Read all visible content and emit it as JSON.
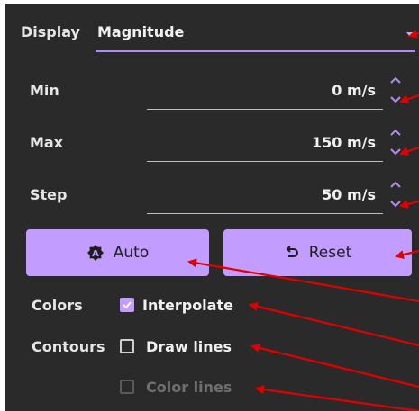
{
  "display": {
    "label": "Display",
    "value": "Magnitude"
  },
  "fields": [
    {
      "label": "Min",
      "value": "0 m/s"
    },
    {
      "label": "Max",
      "value": "150 m/s"
    },
    {
      "label": "Step",
      "value": "50 m/s"
    }
  ],
  "buttons": {
    "auto": "Auto",
    "reset": "Reset"
  },
  "colors": {
    "label": "Colors",
    "interpolate": "Interpolate",
    "interpolate_checked": true
  },
  "contours": {
    "label": "Contours",
    "draw_lines": "Draw lines",
    "draw_lines_checked": false,
    "color_lines": "Color lines",
    "color_lines_checked": false,
    "color_lines_disabled": true
  },
  "theme": {
    "accent": "#c29dff",
    "panel": "#2a2a2a",
    "annotation": "#e00000"
  }
}
